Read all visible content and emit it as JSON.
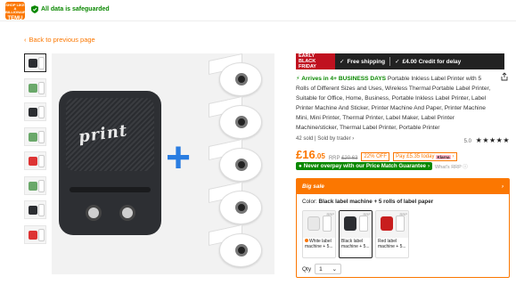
{
  "header": {
    "logo_line1": "SHOP LIKE A BILLIONAIRE",
    "logo_line2": "TEMU",
    "safeguard_text": "All data is safeguarded",
    "accent": "#fb7701",
    "safe_color": "#0a8800"
  },
  "nav": {
    "back_label": "Back to previous page"
  },
  "gallery": {
    "thumbnail_count": 10,
    "main_brand_text": "print"
  },
  "banner": {
    "badge_line1": "EARLY",
    "badge_line2": "BLACK FRIDAY",
    "free_shipping": "Free shipping",
    "credit": "£4.00 Credit for delay"
  },
  "product": {
    "arrives_text": "Arrives in 4+ BUSINESS DAYS",
    "title": "Portable Inkless Label Printer with 5 Rolls of Different Sizes and Uses, Wireless Thermal Portable Label Printer, Suitable for Office, Home, Business, Portable Inkless Label Printer, Label Printer Machine And Sticker, Printer Machine And Paper, Printer Machine Mini, Mini Printer, Thermal Printer, Label Maker, Label Printer Machine/sticker, Thermal Label Printer, Portable Printer",
    "sold": "42 sold",
    "sold_by": "Sold by trader",
    "rating": "5.0",
    "stars": "★★★★★"
  },
  "price": {
    "currency": "£",
    "whole": "16",
    "fraction": ".05",
    "rrp_label": "RRP",
    "rrp_value": "£20.63",
    "discount": "22% OFF",
    "pay_later": "Pay £5.35 today",
    "pay_provider": "Klarna"
  },
  "guarantee": {
    "text": "Never overpay with our Price Match Guarantee",
    "whats_rrp": "What's RRP"
  },
  "sale": {
    "heading": "Big sale",
    "color_prefix": "Color:",
    "color_value": "Black label machine + 5 rolls of label paper",
    "options": [
      {
        "label": "White label machine + 5...",
        "rrp": "RRP",
        "color": "#e8e8e8"
      },
      {
        "label": "Black label machine + 5...",
        "rrp": "RRP",
        "color": "#2b2d31"
      },
      {
        "label": "Red label machine + 5...",
        "rrp": "RRP",
        "color": "#c81e1e"
      }
    ],
    "qty_label": "Qty",
    "qty_value": "1"
  }
}
